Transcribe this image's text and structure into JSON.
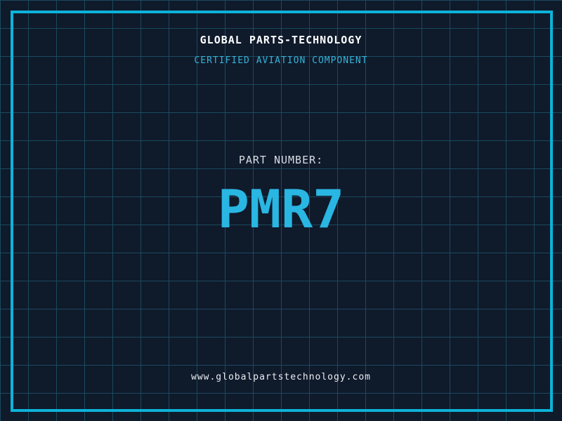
{
  "colors": {
    "background": "#0f1a2b",
    "grid_line": "#1b4a5e",
    "frame_border": "#0db2d8",
    "subtitle_accent": "#36b3d9",
    "part_number_accent": "#29b6e2",
    "heading_text": "#ffffff",
    "label_text": "#d7dde3",
    "footer_text": "#e9edf0"
  },
  "header": {
    "company_name": "GLOBAL PARTS-TECHNOLOGY",
    "subtitle": "CERTIFIED AVIATION COMPONENT"
  },
  "part": {
    "label": "PART NUMBER:",
    "number": "PMR7"
  },
  "footer": {
    "website": "www.globalpartstechnology.com"
  }
}
